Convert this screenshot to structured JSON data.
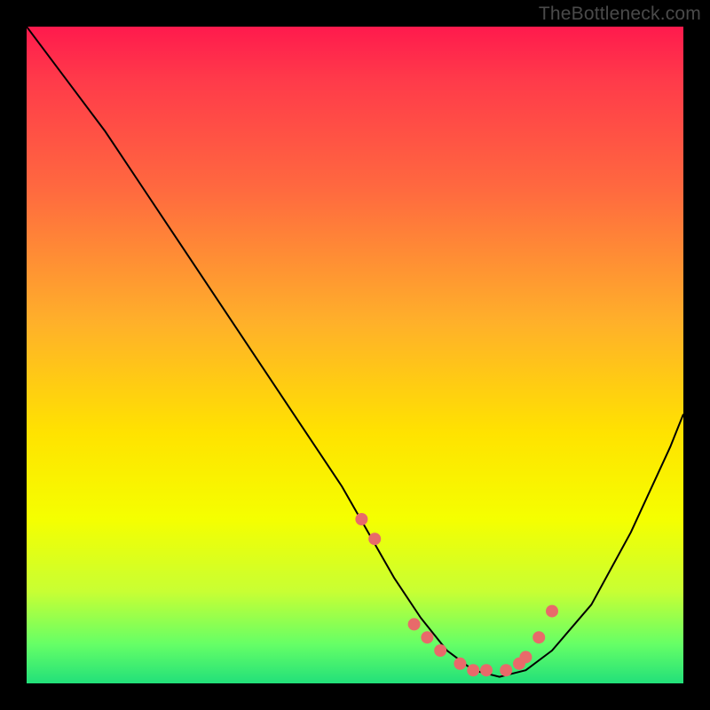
{
  "watermark": "TheBottleneck.com",
  "chart_data": {
    "type": "line",
    "title": "",
    "xlabel": "",
    "ylabel": "",
    "xlim": [
      0,
      100
    ],
    "ylim": [
      0,
      100
    ],
    "series": [
      {
        "name": "bottleneck-curve",
        "x": [
          0,
          6,
          12,
          18,
          24,
          30,
          36,
          42,
          48,
          52,
          56,
          60,
          64,
          68,
          72,
          76,
          80,
          86,
          92,
          98,
          100
        ],
        "values": [
          100,
          92,
          84,
          75,
          66,
          57,
          48,
          39,
          30,
          23,
          16,
          10,
          5,
          2,
          1,
          2,
          5,
          12,
          23,
          36,
          41
        ]
      }
    ],
    "markers": {
      "name": "highlight-points",
      "x": [
        51,
        53,
        59,
        61,
        63,
        66,
        68,
        70,
        73,
        75,
        76,
        78,
        80
      ],
      "values": [
        25,
        22,
        9,
        7,
        5,
        3,
        2,
        2,
        2,
        3,
        4,
        7,
        11
      ],
      "color": "#e86a6a",
      "radius_px": 7
    },
    "colors": {
      "curve": "#000000",
      "marker_fill": "#e86a6a",
      "bg_top": "#ff1a4d",
      "bg_mid": "#ffe300",
      "bg_bottom": "#22e07a"
    }
  }
}
